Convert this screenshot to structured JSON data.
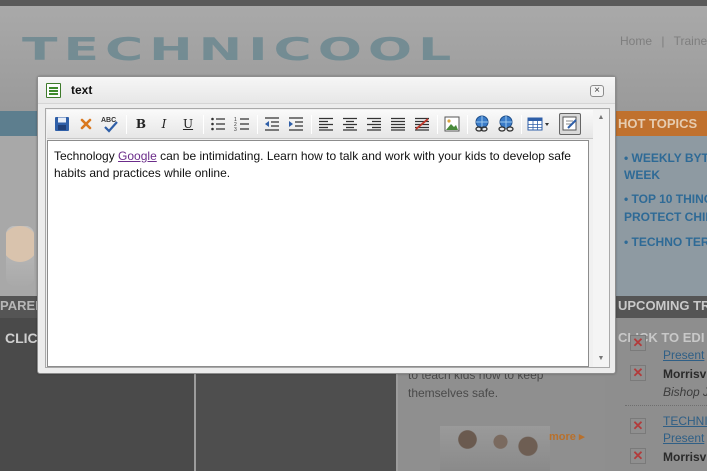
{
  "site": {
    "logo": "TECHNICOOL",
    "topnav": [
      "Home",
      "|",
      "Traine"
    ],
    "hot_topics": {
      "title": "HOT TOPICS",
      "items": [
        "• WEEKLY BYTE",
        "WEEK",
        "• TOP 10 THING",
        "PROTECT CHIL",
        "• TECHNO TERI"
      ]
    },
    "parent_label": "PAREN",
    "upcoming_label": "UPCOMING TRAI",
    "click_label": "CLIC",
    "click_right_label": "CLICK TO EDI",
    "panel_text": [
      "to teach kids how to keep",
      "themselves safe."
    ],
    "more_link": "more ▸",
    "events": [
      {
        "link": "Present",
        "bold": "Morrisv",
        "ital": "Bishop J"
      },
      {
        "link": "TECHNI",
        "link2": "Present",
        "bold": "Morrisv"
      }
    ]
  },
  "dialog": {
    "title": "text",
    "close_glyph": "×",
    "content": {
      "before": "Technology ",
      "link": "Google",
      "after": " can be intimidating. Learn how to talk and work with your kids to develop safe habits and practices while online."
    },
    "toolbar": {
      "save": "save-icon",
      "cancel": "cancel-icon",
      "spellcheck": "ABC",
      "bold": "B",
      "italic": "I",
      "underline": "U",
      "bullet_list": "bullet-list-icon",
      "numbered_list": "numbered-list-icon",
      "outdent": "outdent-icon",
      "indent": "indent-icon",
      "align_left": "align-left-icon",
      "align_center": "align-center-icon",
      "align_right": "align-right-icon",
      "justify": "justify-icon",
      "clear_format": "clear-format-icon",
      "image": "image-icon",
      "link": "link-icon",
      "unlink": "unlink-icon",
      "table": "table-icon",
      "source": "source-icon"
    }
  },
  "colors": {
    "accent_orange": "#c0712e",
    "link_purple": "#6b2c8a",
    "site_blue": "#5d7e8e"
  }
}
